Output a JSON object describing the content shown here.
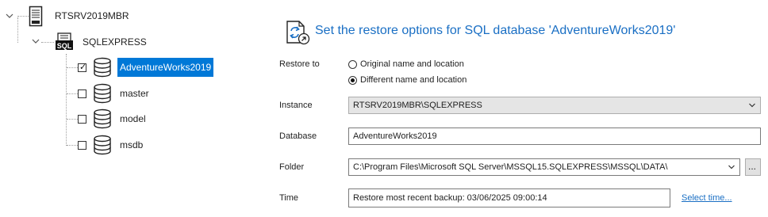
{
  "tree": {
    "server": {
      "label": "RTSRV2019MBR",
      "icon": "server-icon"
    },
    "instance": {
      "label": "SQLEXPRESS",
      "icon": "sql-instance-icon",
      "badge": "SQL"
    },
    "databases": [
      {
        "label": "AdventureWorks2019",
        "checked": true,
        "selected": true
      },
      {
        "label": "master",
        "checked": false,
        "selected": false
      },
      {
        "label": "model",
        "checked": false,
        "selected": false
      },
      {
        "label": "msdb",
        "checked": false,
        "selected": false
      }
    ],
    "check_mark": "✓"
  },
  "panel": {
    "title": "Set the restore options for SQL database 'AdventureWorks2019'",
    "restore_to": {
      "label": "Restore to",
      "options": [
        {
          "label": "Original name and location",
          "selected": false
        },
        {
          "label": "Different name and location",
          "selected": true
        }
      ]
    },
    "instance": {
      "label": "Instance",
      "value": "RTSRV2019MBR\\SQLEXPRESS"
    },
    "database": {
      "label": "Database",
      "value": "AdventureWorks2019"
    },
    "folder": {
      "label": "Folder",
      "value": "C:\\Program Files\\Microsoft SQL Server\\MSSQL15.SQLEXPRESS\\MSSQL\\DATA\\",
      "browse_label": "..."
    },
    "time": {
      "label": "Time",
      "value": "Restore most recent backup: 03/06/2025 09:00:14",
      "link_label": "Select time..."
    }
  },
  "colors": {
    "accent": "#1a6fc4",
    "selection": "#0078d7"
  }
}
